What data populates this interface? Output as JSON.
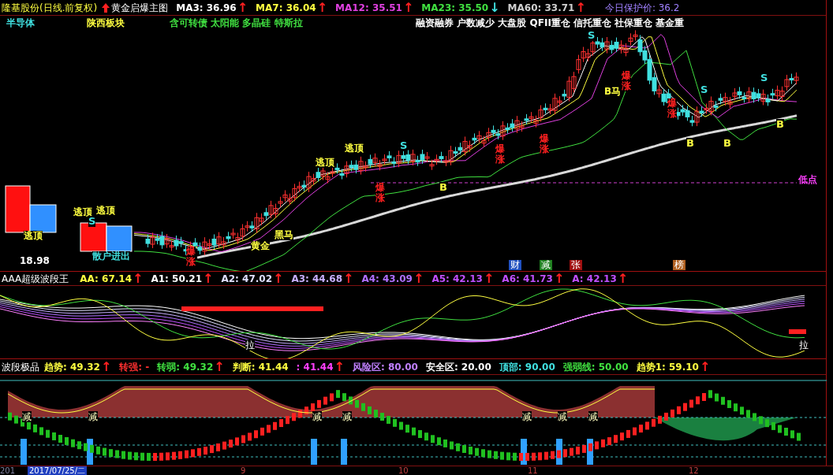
{
  "main": {
    "title": "隆基股份(日线.前复权)",
    "indicator": "黄金启爆主图",
    "ma": [
      {
        "label": "MA3: 36.96",
        "color": "#ffffff",
        "arrow": {
          "text": "↑",
          "rising": true
        }
      },
      {
        "label": "MA7: 36.04",
        "color": "#ffff40",
        "arrow": {
          "text": "↑",
          "rising": true
        }
      },
      {
        "label": "MA12: 35.51",
        "color": "#e040e0",
        "arrow": {
          "text": "↑",
          "rising": true
        }
      },
      {
        "label": "MA23: 35.50",
        "color": "#40e040",
        "arrow": {
          "text": "↓",
          "rising": false
        }
      },
      {
        "label": "MA60: 33.71",
        "color": "#d0d0d0",
        "arrow": {
          "text": "↑",
          "rising": true
        }
      }
    ],
    "protect_price": "今日保护价: 36.2",
    "tags": [
      {
        "text": "半导体",
        "color": "#40e0e0"
      },
      {
        "text": "陕西板块",
        "color": "#ffff40"
      },
      {
        "text": "含可转债 太阳能 多晶硅 特斯拉",
        "color": "#40e040"
      },
      {
        "text": "融资融券 户数减少 大盘股 QFII重仓 信托重仓 社保重仓 基金重",
        "color": "#ffffff"
      }
    ],
    "signals": [
      {
        "text": "18.98",
        "color": "#ffffff"
      },
      {
        "text": "逃顶",
        "color": "#ffff40"
      },
      {
        "text": "逃顶",
        "color": "#ffff40"
      },
      {
        "text": "S",
        "color": "#40e0e0"
      },
      {
        "text": "逃顶",
        "color": "#ffff40"
      },
      {
        "text": "散户进出",
        "color": "#40e0e0"
      },
      {
        "text": "爆涨",
        "color": "#ff2020",
        "kind": "vertical"
      },
      {
        "text": "黄金",
        "color": "#ffff40"
      },
      {
        "text": "黑马",
        "color": "#ffff40"
      },
      {
        "text": "逃顶",
        "color": "#ffff40"
      },
      {
        "text": "逃顶",
        "color": "#ffff40"
      },
      {
        "text": "爆涨",
        "color": "#ff2020",
        "kind": "vertical"
      },
      {
        "text": "S",
        "color": "#40e0e0"
      },
      {
        "text": "B",
        "color": "#ffff40"
      },
      {
        "text": "爆涨",
        "color": "#ff2020",
        "kind": "vertical"
      },
      {
        "text": "爆涨",
        "color": "#ff2020",
        "kind": "vertical"
      },
      {
        "text": "S",
        "color": "#40e0e0"
      },
      {
        "text": "B马",
        "color": "#ffff40"
      },
      {
        "text": "爆涨",
        "color": "#ff2020",
        "kind": "vertical"
      },
      {
        "text": "爆涨",
        "color": "#ff2020",
        "kind": "vertical"
      },
      {
        "text": "B",
        "color": "#ffff40"
      },
      {
        "text": "S",
        "color": "#40e0e0"
      },
      {
        "text": "B",
        "color": "#ffff40"
      },
      {
        "text": "S",
        "color": "#40e0e0"
      },
      {
        "text": "B",
        "color": "#ffff40"
      },
      {
        "text": "低点",
        "color": "#ff40ff"
      }
    ],
    "events": [
      {
        "text": "财",
        "color": "#2050c0"
      },
      {
        "text": "减",
        "color": "#208020"
      },
      {
        "text": "张",
        "color": "#a01010"
      },
      {
        "text": "榜",
        "color": "#b06020"
      }
    ]
  },
  "wave": {
    "title": "AAA超级波段王",
    "values": [
      {
        "label": "AA: 67.14",
        "color": "#ffff40",
        "arrow": {
          "text": "↑",
          "rising": true
        }
      },
      {
        "label": "A1: 50.21",
        "color": "#ffffff",
        "arrow": {
          "text": "↑",
          "rising": true
        }
      },
      {
        "label": "A2: 47.02",
        "color": "#e0e0ff",
        "arrow": {
          "text": "↑",
          "rising": true
        }
      },
      {
        "label": "A3: 44.68",
        "color": "#c8b0ff",
        "arrow": {
          "text": "↑",
          "rising": true
        }
      },
      {
        "label": "A4: 43.09",
        "color": "#b070ff",
        "arrow": {
          "text": "↑",
          "rising": true
        }
      },
      {
        "label": "A5: 42.13",
        "color": "#c050ff",
        "arrow": {
          "text": "↑",
          "rising": true
        }
      },
      {
        "label": "A6: 41.73",
        "color": "#c050ff",
        "arrow": {
          "text": "↑",
          "rising": true
        }
      },
      {
        "label": "A: 42.13",
        "color": "#c050ff",
        "arrow": {
          "text": "↑",
          "rising": true
        }
      }
    ],
    "marks": [
      "拉",
      "拉"
    ]
  },
  "band": {
    "title": "波段极品",
    "values": [
      {
        "label": "趋势: 49.32",
        "color": "#ffff40",
        "arrow": {
          "text": "↑",
          "rising": true
        }
      },
      {
        "label": "转强: -",
        "color": "#ff3030"
      },
      {
        "label": "转弱: 49.32",
        "color": "#40e040",
        "arrow": {
          "text": "↑",
          "rising": true
        }
      },
      {
        "label": "判断: 41.44",
        "color": "#ffff40"
      },
      {
        "label": ": 41.44",
        "color": "#ff40ff",
        "arrow": {
          "text": "↑",
          "rising": true
        }
      },
      {
        "label": "风险区: 80.00",
        "color": "#c080ff"
      },
      {
        "label": "安全区: 20.00",
        "color": "#ffffff"
      },
      {
        "label": "顶部: 90.00",
        "color": "#40e0e0"
      },
      {
        "label": "强弱线: 50.00",
        "color": "#40e040"
      },
      {
        "label": "趋势1: 59.10",
        "color": "#ffff40",
        "arrow": {
          "text": "↑",
          "rising": true
        }
      }
    ],
    "marks": [
      "减",
      "减",
      "减",
      "减",
      "减",
      "减",
      "减"
    ]
  },
  "axis": {
    "start": "201",
    "date": "2017/07/25/二",
    "months": [
      "9",
      "10",
      "11",
      "12"
    ]
  }
}
